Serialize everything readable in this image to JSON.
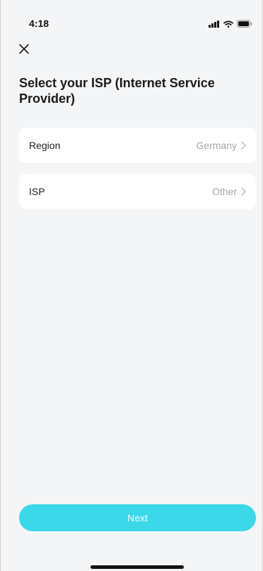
{
  "status_bar": {
    "time": "4:18"
  },
  "header": {
    "title": "Select your ISP (Internet Service Provider)"
  },
  "rows": [
    {
      "label": "Region",
      "value": "Germany"
    },
    {
      "label": "ISP",
      "value": "Other"
    }
  ],
  "footer": {
    "next_label": "Next"
  },
  "colors": {
    "accent": "#3ad8e8",
    "background": "#f4f5f7",
    "card": "#ffffff",
    "muted_text": "#a5a5a5"
  }
}
